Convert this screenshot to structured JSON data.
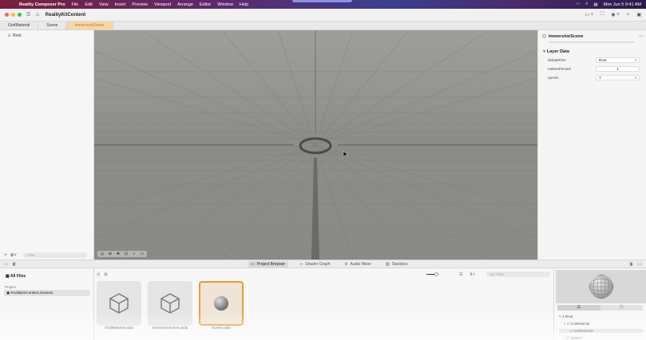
{
  "menubar": {
    "app_name": "Reality Composer Pro",
    "menus": [
      "File",
      "Edit",
      "View",
      "Insert",
      "Preview",
      "Viewport",
      "Arrange",
      "Editor",
      "Window",
      "Help"
    ],
    "clock": "Mon Jun 5  9:41 AM"
  },
  "toolbar": {
    "title": "RealityKitContent"
  },
  "tabs": [
    "GridMaterial",
    "Scene",
    "ImmersiveScene"
  ],
  "hierarchy": {
    "root": "Root",
    "filter_placeholder": "Filter"
  },
  "inspector": {
    "title": "ImmersiveScene",
    "section": "Layer Data",
    "rows": [
      {
        "label": "defaultPrim",
        "value": "Root"
      },
      {
        "label": "metersPerUnit",
        "value": "1"
      },
      {
        "label": "upAxis",
        "value": "Y"
      }
    ]
  },
  "bottom_tabs": [
    "Project Browser",
    "Shader Graph",
    "Audio Mixer",
    "Statistics"
  ],
  "files": {
    "all_files": "All Files",
    "project_label": "Project",
    "project_item": "RealityKitContent.rkassets"
  },
  "browser": {
    "filter_placeholder": "Filter",
    "assets": [
      "GridMaterial.usda",
      "ImmersiveScene.usda",
      "Scene.usda"
    ]
  },
  "preview": {
    "tree": [
      "Root",
      "GridMaterial",
      "GridMaterial",
      "Sphere"
    ]
  },
  "colors": {
    "accent": "#e89a3c",
    "viewport_bg": "#8f8f8b"
  }
}
